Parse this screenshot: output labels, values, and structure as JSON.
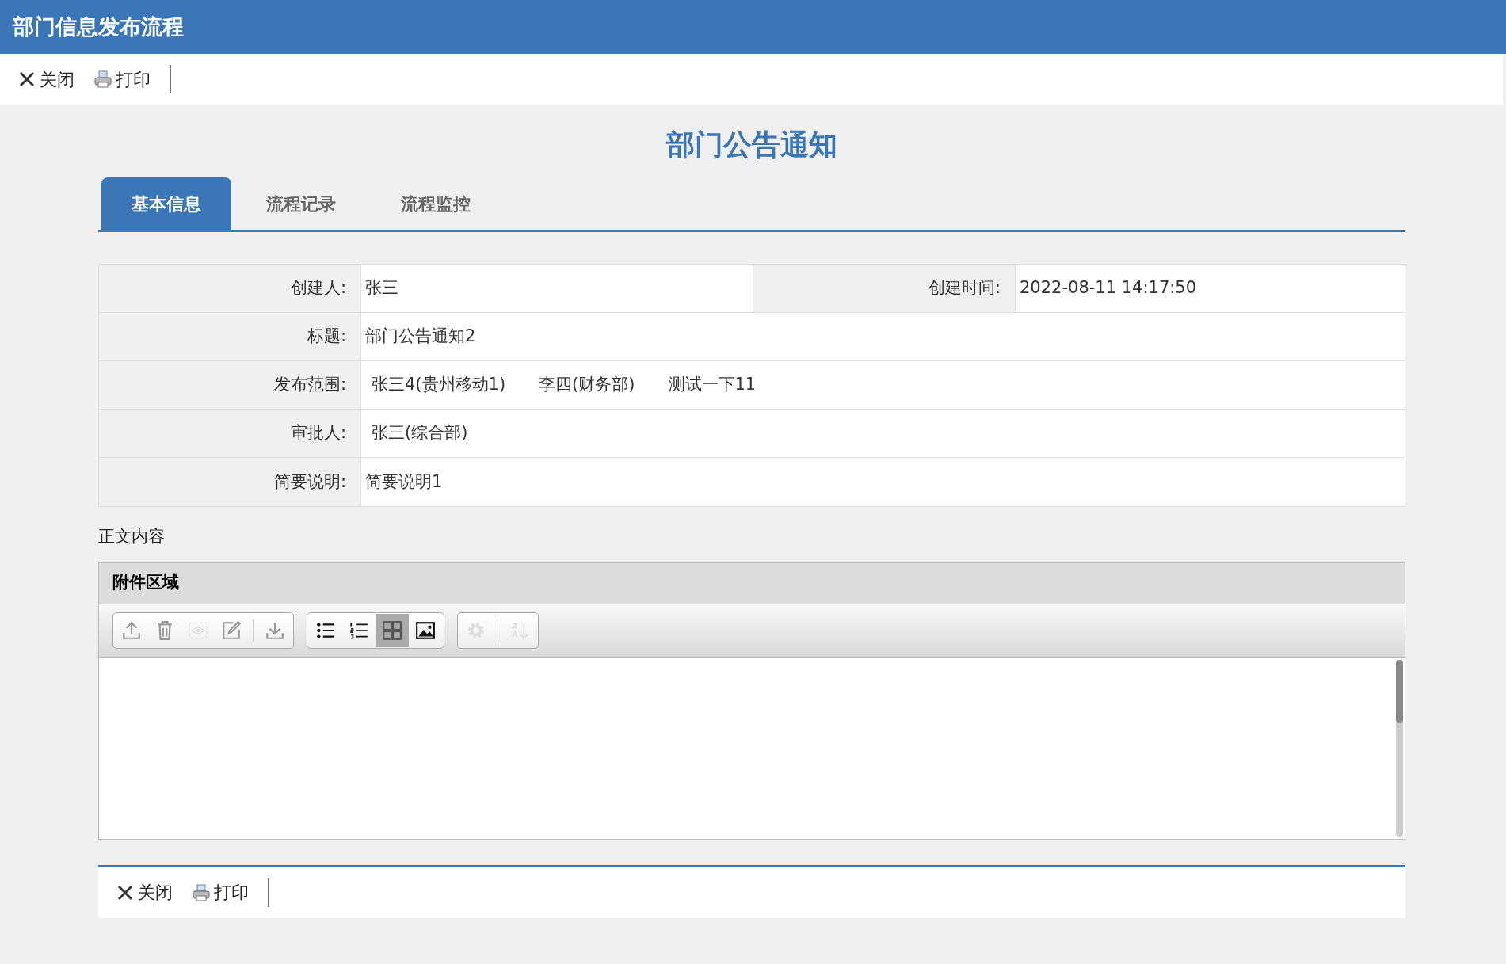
{
  "window": {
    "title": "部门信息发布流程"
  },
  "toolbar": [
    {
      "kind": "close",
      "label": "关闭"
    },
    {
      "kind": "print",
      "label": "打印"
    }
  ],
  "form_title": "部门公告通知",
  "tabs": [
    {
      "label": "基本信息",
      "selected": true
    },
    {
      "label": "流程记录",
      "selected": false
    },
    {
      "label": "流程监控",
      "selected": false
    }
  ],
  "form_rows": [
    {
      "cells": [
        {
          "label": "创建人:",
          "kind": "text",
          "value": "张三"
        },
        {
          "label": "创建时间:",
          "kind": "text",
          "value": "2022-08-11 14:17:50"
        }
      ]
    },
    {
      "cells": [
        {
          "label": "标题:",
          "kind": "text",
          "value": "部门公告通知2"
        }
      ]
    },
    {
      "cells": [
        {
          "label": "发布范围:",
          "kind": "people",
          "values": [
            "张三4(贵州移动1)",
            "李四(财务部)",
            "测试一下11"
          ]
        }
      ]
    },
    {
      "cells": [
        {
          "label": "审批人:",
          "kind": "people",
          "values": [
            "张三(综合部)"
          ]
        }
      ]
    },
    {
      "cells": [
        {
          "label": "简要说明:",
          "kind": "text",
          "value": "简要说明1"
        }
      ]
    }
  ],
  "body_label": "正文内容",
  "attachments": {
    "title": "附件区域",
    "tool_groups": [
      [
        {
          "kind": "upload",
          "disabled": false,
          "selected": false
        },
        {
          "kind": "delete",
          "disabled": false,
          "selected": false
        },
        {
          "kind": "preview",
          "disabled": true,
          "selected": false
        },
        {
          "kind": "edit",
          "disabled": false,
          "selected": false
        },
        {
          "kind": "sep"
        },
        {
          "kind": "download",
          "disabled": false,
          "selected": false
        }
      ],
      [
        {
          "kind": "list",
          "disabled": false,
          "selected": false
        },
        {
          "kind": "numbered",
          "disabled": false,
          "selected": false
        },
        {
          "kind": "grid",
          "disabled": false,
          "selected": true
        },
        {
          "kind": "image",
          "disabled": false,
          "selected": false
        }
      ],
      [
        {
          "kind": "settings",
          "disabled": true,
          "selected": false
        },
        {
          "kind": "sep"
        },
        {
          "kind": "sort",
          "disabled": true,
          "selected": false
        }
      ]
    ]
  },
  "bottom_toolbar": [
    {
      "kind": "close",
      "label": "关闭"
    },
    {
      "kind": "print",
      "label": "打印"
    }
  ]
}
